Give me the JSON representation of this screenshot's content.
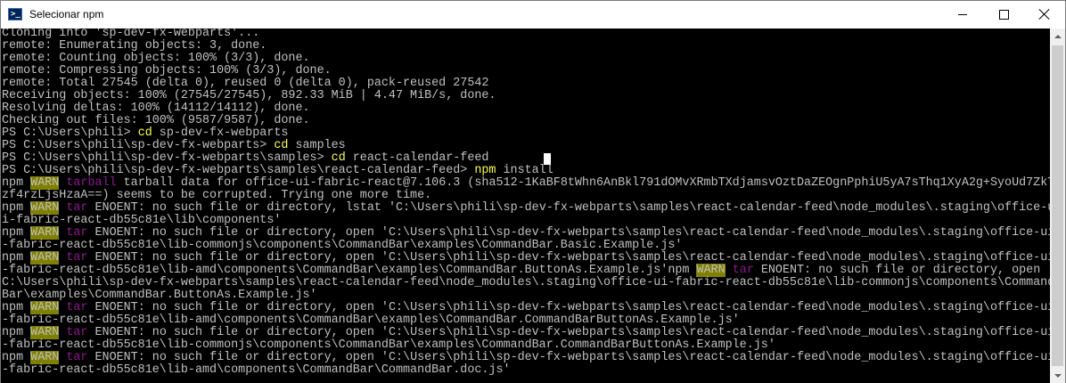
{
  "window": {
    "title": "Selecionar npm",
    "icon": "powershell-icon",
    "controls": [
      "minimize-icon",
      "maximize-icon",
      "close-icon"
    ]
  },
  "colors": {
    "console_bg": "#000000",
    "console_text": "#c0c0c0",
    "command_text": "#ffff54",
    "warn_bg": "#808000",
    "tar_text": "#8b1a8b"
  },
  "console": {
    "lines": [
      "Cloning into 'sp-dev-fx-webparts'...",
      "remote: Enumerating objects: 3, done.",
      "remote: Counting objects: 100% (3/3), done.",
      "remote: Compressing objects: 100% (3/3), done.",
      "remote: Total 27545 (delta 0), reused 0 (delta 0), pack-reused 27542",
      "Receiving objects: 100% (27545/27545), 892.33 MiB | 4.47 MiB/s, done.",
      "Resolving deltas: 100% (14112/14112), done.",
      "Checking out files: 100% (9587/9587), done."
    ],
    "prompts": [
      {
        "prompt": "PS C:\\Users\\phili> ",
        "cmd": "cd",
        "arg": " sp-dev-fx-webparts"
      },
      {
        "prompt": "PS C:\\Users\\phili\\sp-dev-fx-webparts> ",
        "cmd": "cd",
        "arg": " samples"
      },
      {
        "prompt": "PS C:\\Users\\phili\\sp-dev-fx-webparts\\samples> ",
        "cmd": "cd",
        "arg": " react-calendar-feed"
      },
      {
        "prompt": "PS C:\\Users\\phili\\sp-dev-fx-webparts\\samples\\react-calendar-feed> ",
        "cmd": "npm",
        "arg": " install"
      }
    ],
    "npm": "npm",
    "warn": "WARN",
    "tarball": "tarball",
    "tar": "tar",
    "w1a": " tarball data for office-ui-fabric-react@7.106.3 (sha512-1KaBF8tWhn6AnBkl791dOMvXRmbTXdjamsvOztDaZEOgnPphiU5yA7sThq1XyA2g+SyoUd7ZkT",
    "w1b": "zf4rzLjsHzaA==) seems to be corrupted. Trying one more time.",
    "w2a": " ENOENT: no such file or directory, lstat 'C:\\Users\\phili\\sp-dev-fx-webparts\\samples\\react-calendar-feed\\node_modules\\.staging\\office-u",
    "w2b": "i-fabric-react-db55c81e\\lib\\components'",
    "w3a": " ENOENT: no such file or directory, open 'C:\\Users\\phili\\sp-dev-fx-webparts\\samples\\react-calendar-feed\\node_modules\\.staging\\office-ui",
    "w3b": "-fabric-react-db55c81e\\lib-commonjs\\components\\CommandBar\\examples\\CommandBar.Basic.Example.js'",
    "w4a": " ENOENT: no such file or directory, open 'C:\\Users\\phili\\sp-dev-fx-webparts\\samples\\react-calendar-feed\\node_modules\\.staging\\office-ui",
    "w4b": "-fabric-react-db55c81e\\lib-amd\\components\\CommandBar\\examples\\CommandBar.ButtonAs.Example.js'",
    "w4c": " ENOENT: no such file or directory, open '",
    "w4d": "C:\\Users\\phili\\sp-dev-fx-webparts\\samples\\react-calendar-feed\\node_modules\\.staging\\office-ui-fabric-react-db55c81e\\lib-commonjs\\components\\Command",
    "w4e": "Bar\\examples\\CommandBar.ButtonAs.Example.js'",
    "w5a": " ENOENT: no such file or directory, open 'C:\\Users\\phili\\sp-dev-fx-webparts\\samples\\react-calendar-feed\\node_modules\\.staging\\office-ui",
    "w5b": "-fabric-react-db55c81e\\lib-amd\\components\\CommandBar\\examples\\CommandBar.CommandBarButtonAs.Example.js'",
    "w6a": " ENOENT: no such file or directory, open 'C:\\Users\\phili\\sp-dev-fx-webparts\\samples\\react-calendar-feed\\node_modules\\.staging\\office-ui",
    "w6b": "-fabric-react-db55c81e\\lib-commonjs\\components\\CommandBar\\examples\\CommandBar.CommandBarButtonAs.Example.js'",
    "w7a": " ENOENT: no such file or directory, open 'C:\\Users\\phili\\sp-dev-fx-webparts\\samples\\react-calendar-feed\\node_modules\\.staging\\office-ui",
    "w7b": "-fabric-react-db55c81e\\lib-amd\\components\\CommandBar\\CommandBar.doc.js'"
  }
}
